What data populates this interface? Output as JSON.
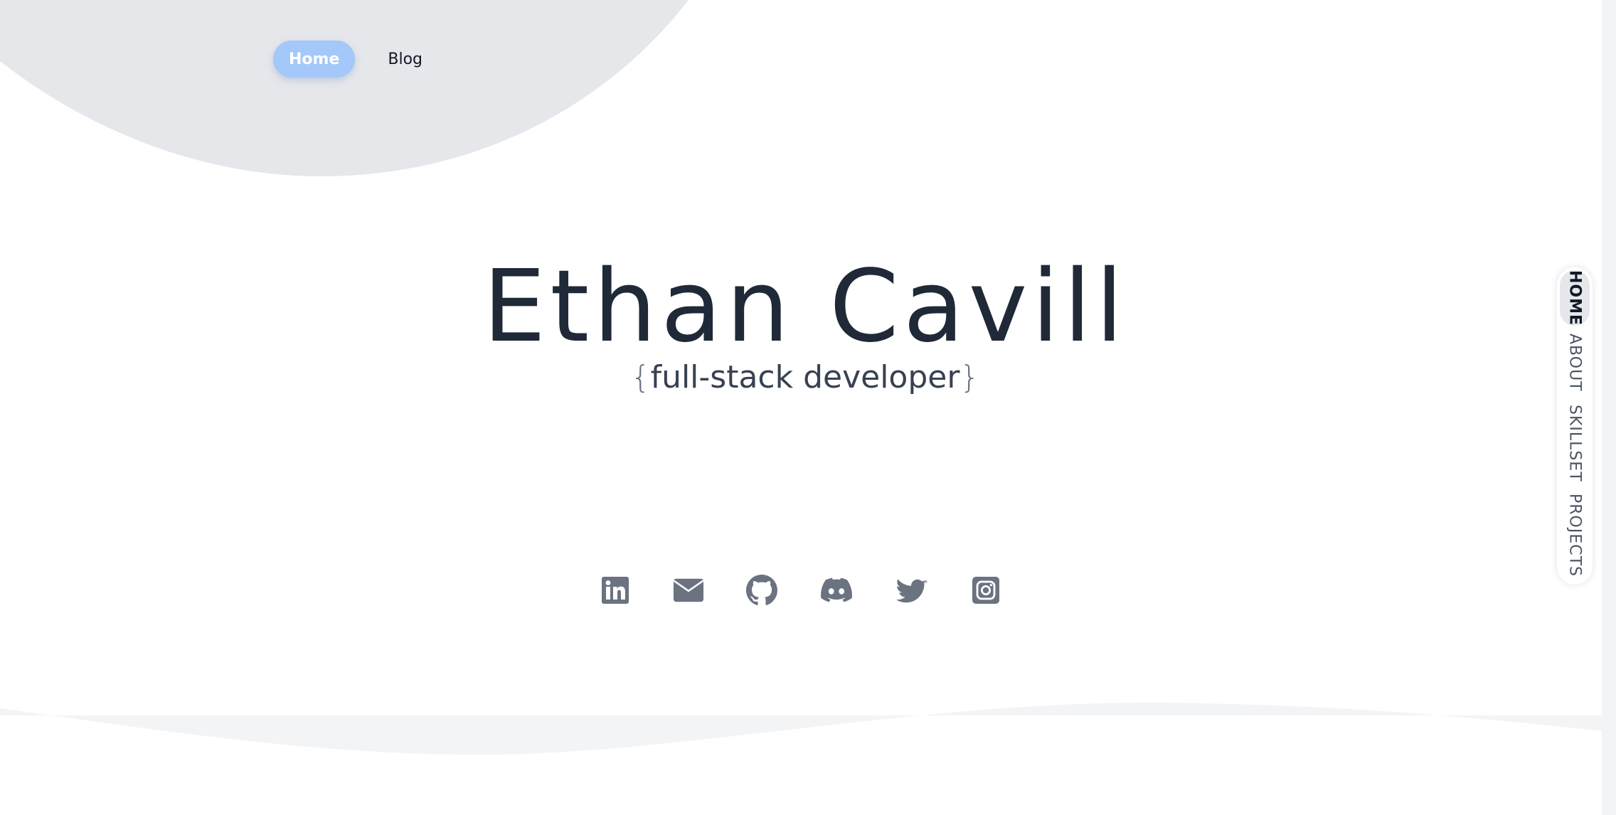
{
  "top_nav": {
    "items": [
      {
        "label": "Home",
        "active": true
      },
      {
        "label": "Blog",
        "active": false
      }
    ]
  },
  "hero": {
    "name": "Ethan Cavill",
    "role_open": "{",
    "role": "full-stack developer",
    "role_close": "}"
  },
  "socials": [
    {
      "icon": "linkedin-icon"
    },
    {
      "icon": "mail-icon"
    },
    {
      "icon": "github-icon"
    },
    {
      "icon": "discord-icon"
    },
    {
      "icon": "twitter-icon"
    },
    {
      "icon": "instagram-icon"
    }
  ],
  "side_nav": {
    "items": [
      {
        "label": "HOME",
        "active": true
      },
      {
        "label": "ABOUT",
        "active": false
      },
      {
        "label": "SKILLSET",
        "active": false
      },
      {
        "label": "PROJECTS",
        "active": false
      }
    ]
  },
  "colors": {
    "accent_pill": "#a3c8f9",
    "heading": "#1f2937",
    "icon": "#6b7280",
    "blob": "#e5e7eb",
    "wave": "#f3f4f6"
  }
}
